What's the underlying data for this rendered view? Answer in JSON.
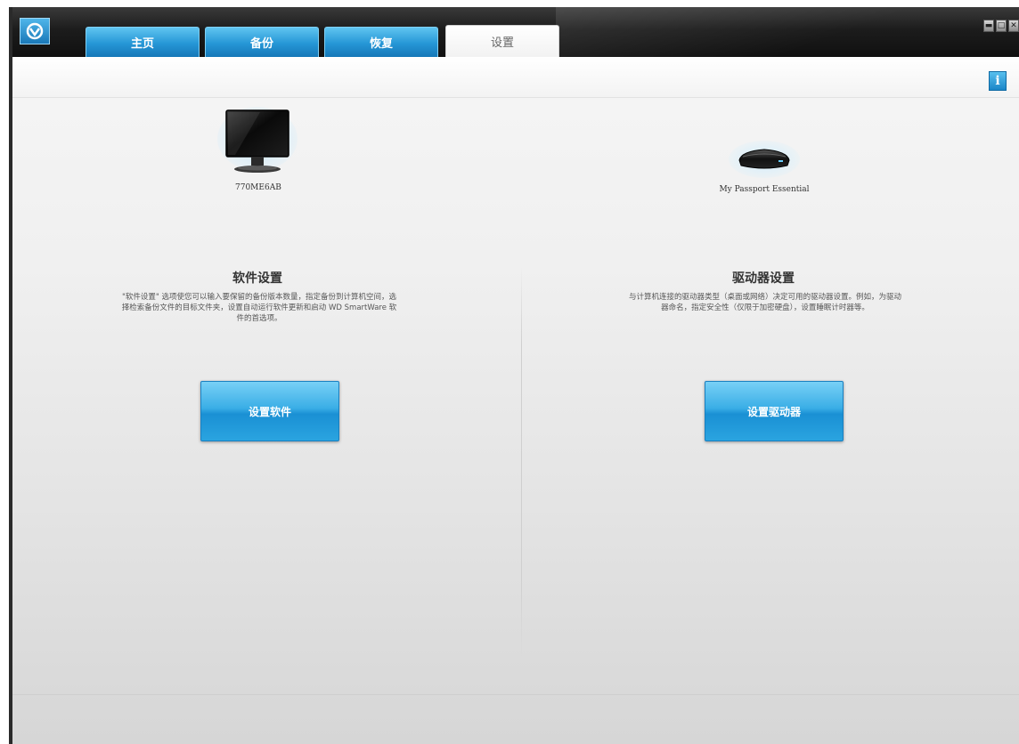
{
  "window": {
    "logo_icon": "wd-smartware-logo-icon"
  },
  "tabs": [
    {
      "label": "主页",
      "active": false
    },
    {
      "label": "备份",
      "active": false
    },
    {
      "label": "恢复",
      "active": false
    },
    {
      "label": "设置",
      "active": true
    }
  ],
  "window_controls": {
    "minimize": "▬",
    "maximize": "□",
    "close": "✕"
  },
  "info_button_label": "i",
  "left_panel": {
    "device_label": "770ME6AB",
    "device_icon": "monitor-icon",
    "title": "软件设置",
    "description": "\"软件设置\" 选项使您可以输入要保留的备份版本数量，指定备份到计算机空间，选择检索备份文件的目标文件夹，设置自动运行软件更新和启动 WD SmartWare 软件的首选项。",
    "button_label": "设置软件"
  },
  "right_panel": {
    "device_label": "My Passport Essential",
    "device_icon": "external-drive-icon",
    "title": "驱动器设置",
    "description": "与计算机连接的驱动器类型（桌面或网络）决定可用的驱动器设置。例如，为驱动器命名，指定安全性（仅限于加密硬盘），设置睡眠计时器等。",
    "button_label": "设置驱动器"
  },
  "colors": {
    "tab_blue": "#2596d6",
    "button_blue": "#3aaee6",
    "titlebar": "#1c1c1c",
    "content_bg": "#f0f0f0"
  }
}
